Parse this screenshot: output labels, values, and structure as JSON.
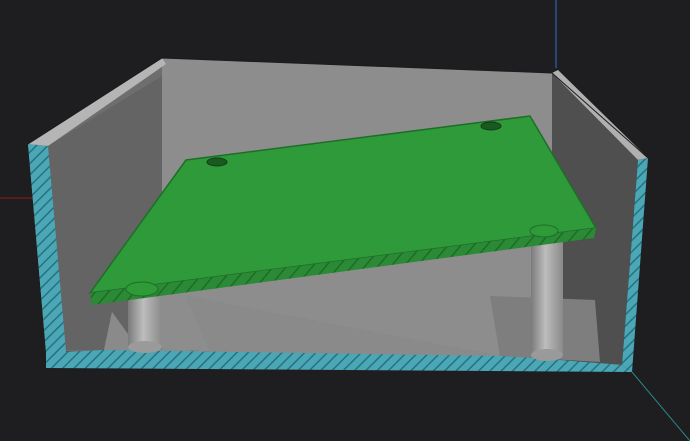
{
  "viewport": {
    "background": "#1e1e21",
    "axes": {
      "x_axis_color": "#9a1f1f",
      "y_axis_color": "#2f6fd6",
      "z_axis_color": "#2a8a8a"
    }
  },
  "scene": {
    "enclosure": {
      "wall_color": "#8a8a8a",
      "inner_wall_dark": "#5b5b5b",
      "cut_face_color": "#4aa7b6",
      "cut_hatch_color": "#2c6f7e"
    },
    "pcb": {
      "top_color": "#2f9a3a",
      "edge_color": "#1e6e28",
      "hole_color": "#1a5a21"
    },
    "standoffs": {
      "color": "#a5a5a5",
      "shadow": "#6f6f6f"
    }
  }
}
